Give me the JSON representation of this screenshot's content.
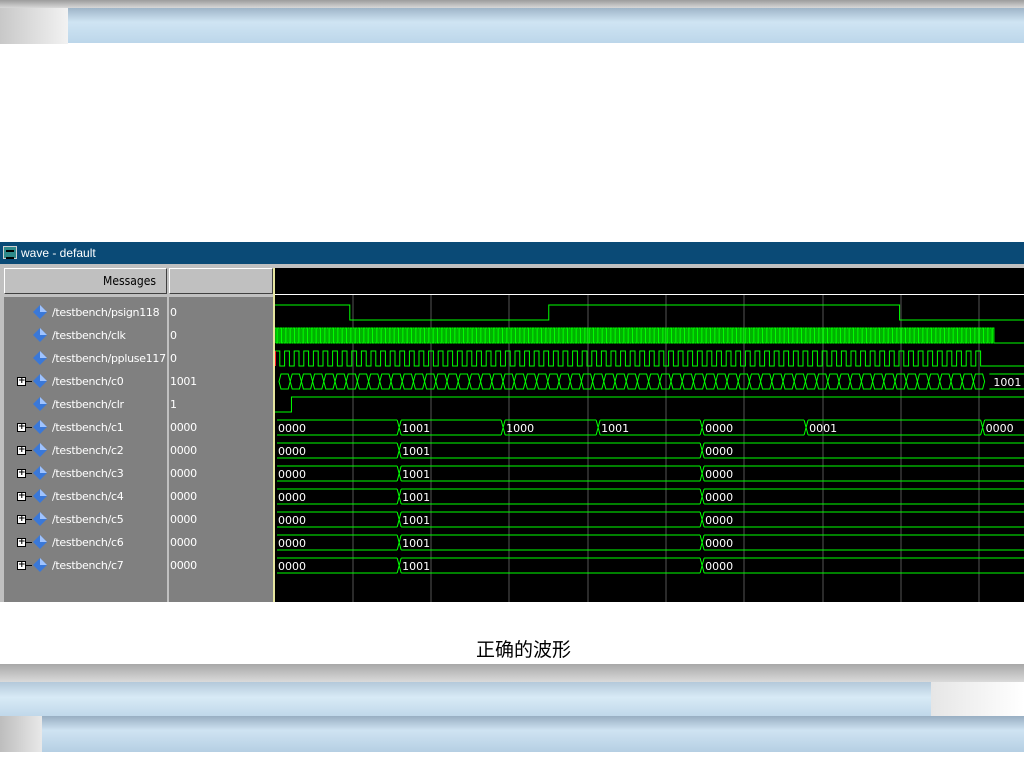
{
  "window": {
    "title": "wave - default"
  },
  "panes": {
    "messages_header": "Messages",
    "values_header": ""
  },
  "signals": [
    {
      "name": "/testbench/psign118",
      "value": "0",
      "bus": false
    },
    {
      "name": "/testbench/clk",
      "value": "0",
      "bus": false
    },
    {
      "name": "/testbench/ppluse117",
      "value": "0",
      "bus": false
    },
    {
      "name": "/testbench/c0",
      "value": "1001",
      "bus": true
    },
    {
      "name": "/testbench/clr",
      "value": "1",
      "bus": false
    },
    {
      "name": "/testbench/c1",
      "value": "0000",
      "bus": true
    },
    {
      "name": "/testbench/c2",
      "value": "0000",
      "bus": true
    },
    {
      "name": "/testbench/c3",
      "value": "0000",
      "bus": true
    },
    {
      "name": "/testbench/c4",
      "value": "0000",
      "bus": true
    },
    {
      "name": "/testbench/c5",
      "value": "0000",
      "bus": true
    },
    {
      "name": "/testbench/c6",
      "value": "0000",
      "bus": true
    },
    {
      "name": "/testbench/c7",
      "value": "0000",
      "bus": true
    }
  ],
  "waves": {
    "psign118": [
      [
        0,
        1
      ],
      [
        0.1,
        0
      ],
      [
        0.366,
        1
      ],
      [
        0.835,
        0
      ]
    ],
    "clr": [
      [
        0,
        0
      ],
      [
        0.022,
        1
      ]
    ],
    "c0_end_label": "1001",
    "c1": [
      {
        "t": 0,
        "label": "0000"
      },
      {
        "t": 0.166,
        "label": "1001"
      },
      {
        "t": 0.305,
        "label": "1000"
      },
      {
        "t": 0.432,
        "label": "1001"
      },
      {
        "t": 0.571,
        "label": "0000"
      },
      {
        "t": 0.71,
        "label": "0001"
      },
      {
        "t": 0.946,
        "label": "0000"
      }
    ],
    "c2_c7": [
      {
        "t": 0,
        "label": "0000"
      },
      {
        "t": 0.166,
        "label": "1001"
      },
      {
        "t": 0.571,
        "label": "0000"
      }
    ]
  },
  "caption": "正确的波形",
  "colors": {
    "wave": "#00ff00",
    "grid": "#555555",
    "titlebar": "#0a4a76",
    "cursor": "#e6e6a0",
    "diamond": "#3a78d8"
  }
}
